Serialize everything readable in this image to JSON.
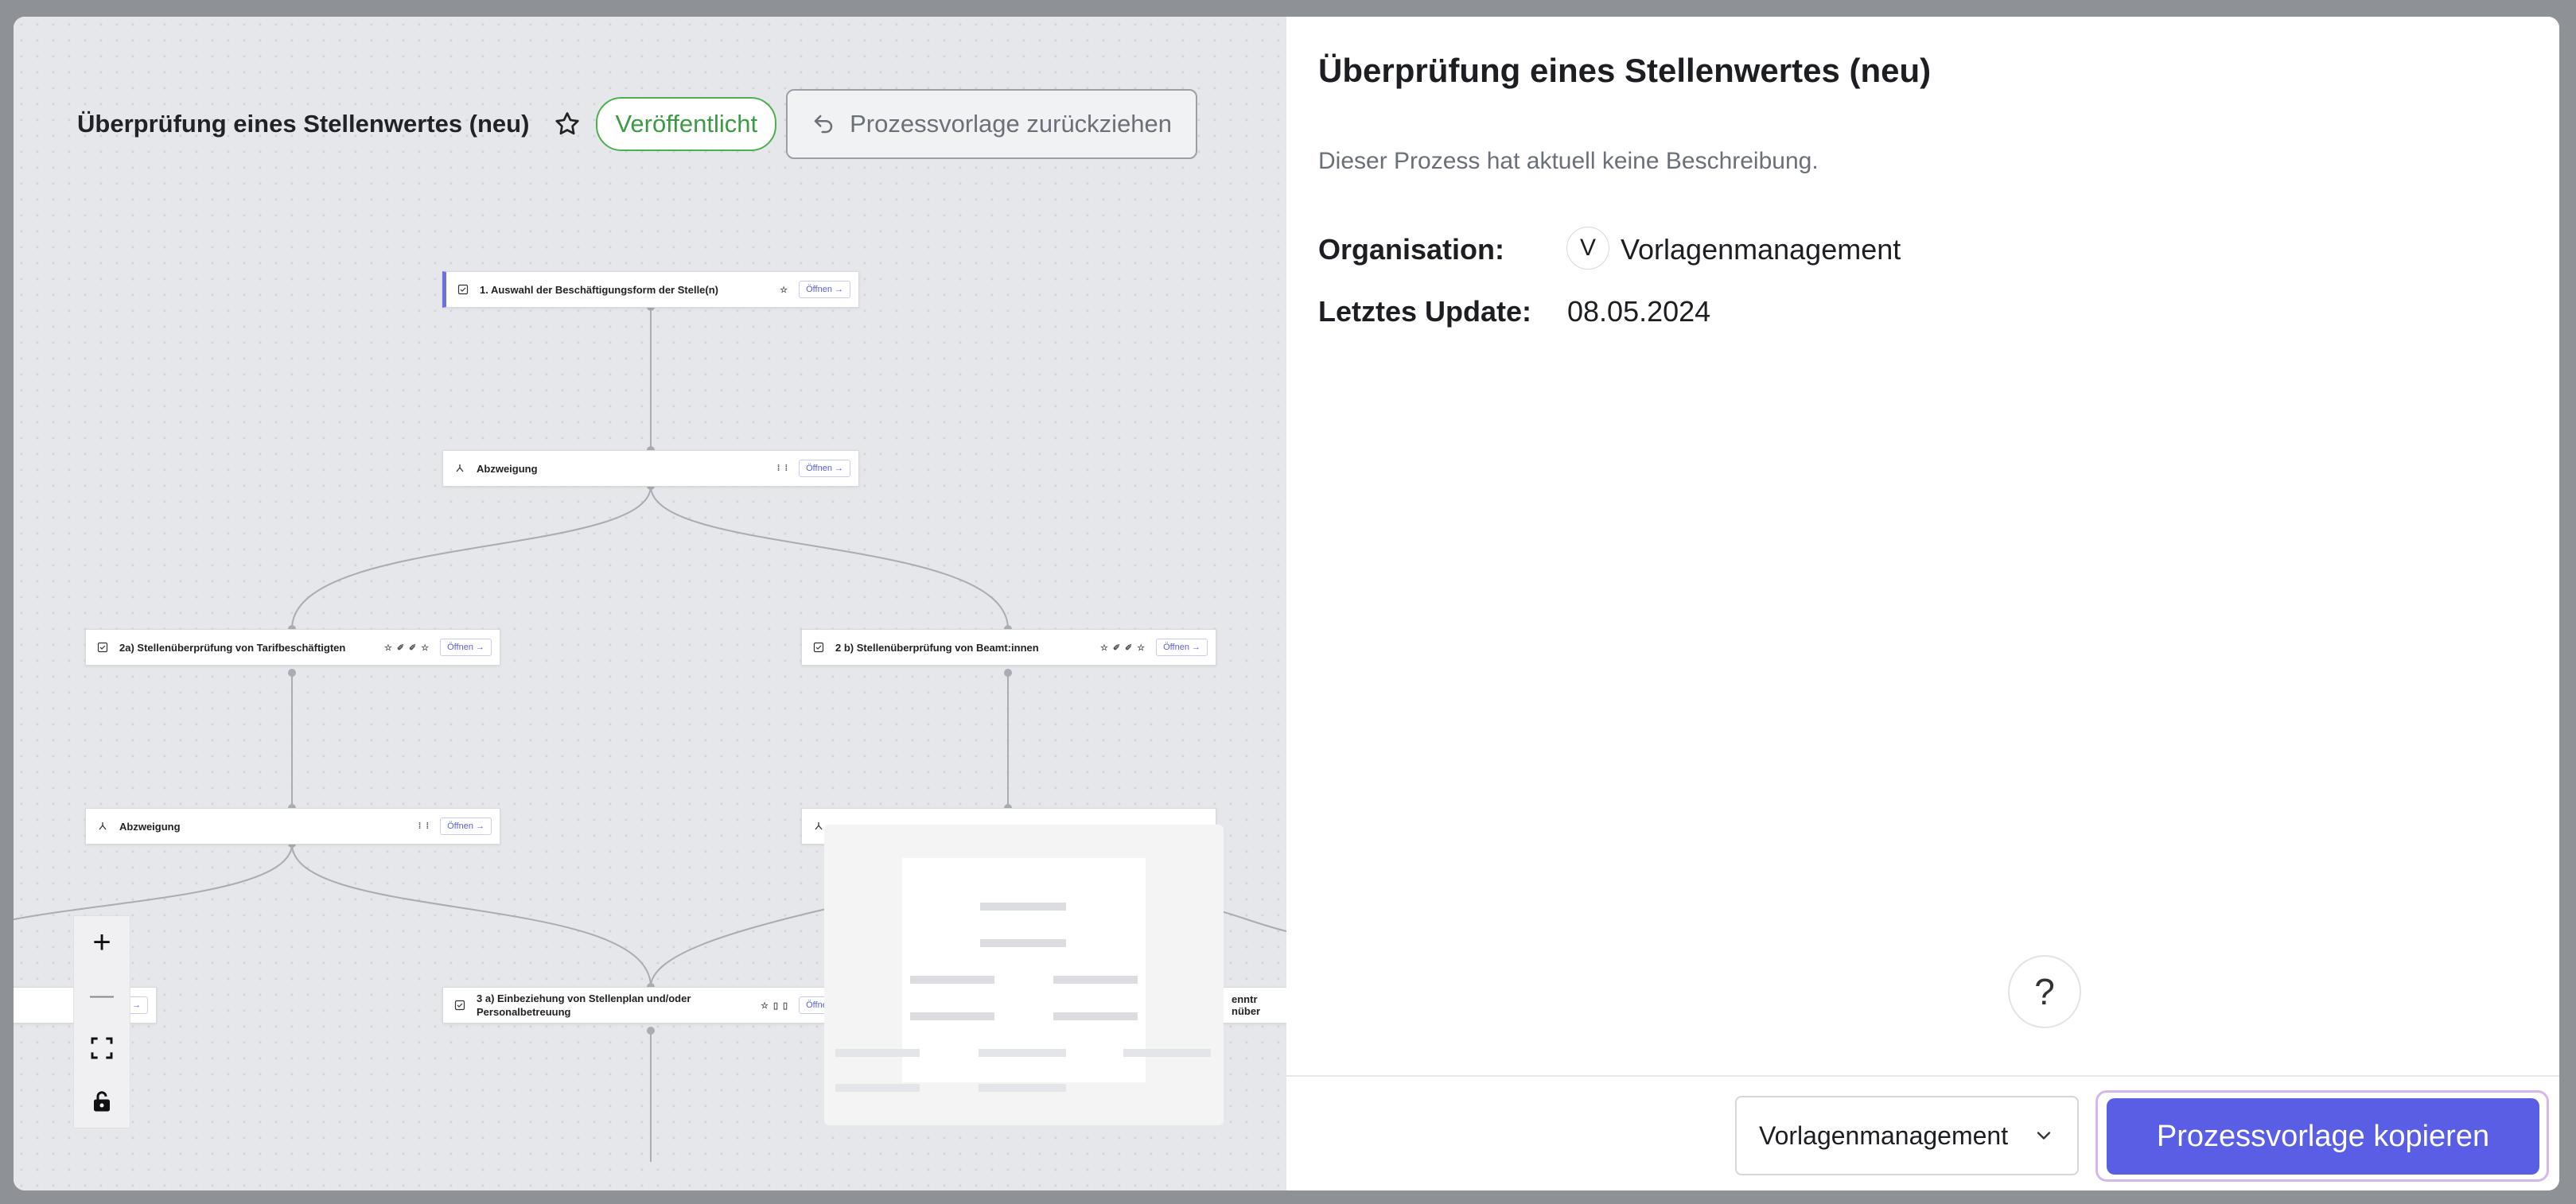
{
  "flow": {
    "title": "Überprüfung eines Stellenwertes (neu)",
    "status_badge": "Veröffentlicht",
    "withdraw_label": "Prozessvorlage zurückziehen",
    "open_label": "Öffnen",
    "nodes": [
      {
        "label": "1. Auswahl der Beschäftigungsform der Stelle(n)"
      },
      {
        "label": "Abzweigung"
      },
      {
        "label": "2a) Stellenüberprüfung von Tarifbeschäftigten"
      },
      {
        "label": "2 b) Stellenüberprüfung von Beamt:innen"
      },
      {
        "label": "Abzweigung"
      },
      {
        "label": "3 a) Einbeziehung von Stellenplan und/oder Personalbetreuung"
      },
      {
        "label": "enntr"
      },
      {
        "label": "nüber"
      }
    ],
    "controls": {
      "zoom_in": "+",
      "zoom_out": "—"
    }
  },
  "panel": {
    "title": "Überprüfung eines Stellenwertes (neu)",
    "description": "Dieser Prozess hat aktuell keine Beschreibung.",
    "org_label": "Organisation:",
    "org_avatar": "V",
    "org_value": "Vorlagenmanagement",
    "update_label": "Letztes Update:",
    "update_value": "08.05.2024",
    "help": "?"
  },
  "footer": {
    "select_value": "Vorlagenmanagement",
    "copy_label": "Prozessvorlage kopieren"
  },
  "colors": {
    "accent": "#5a5ee5",
    "published": "#3c9a45"
  }
}
